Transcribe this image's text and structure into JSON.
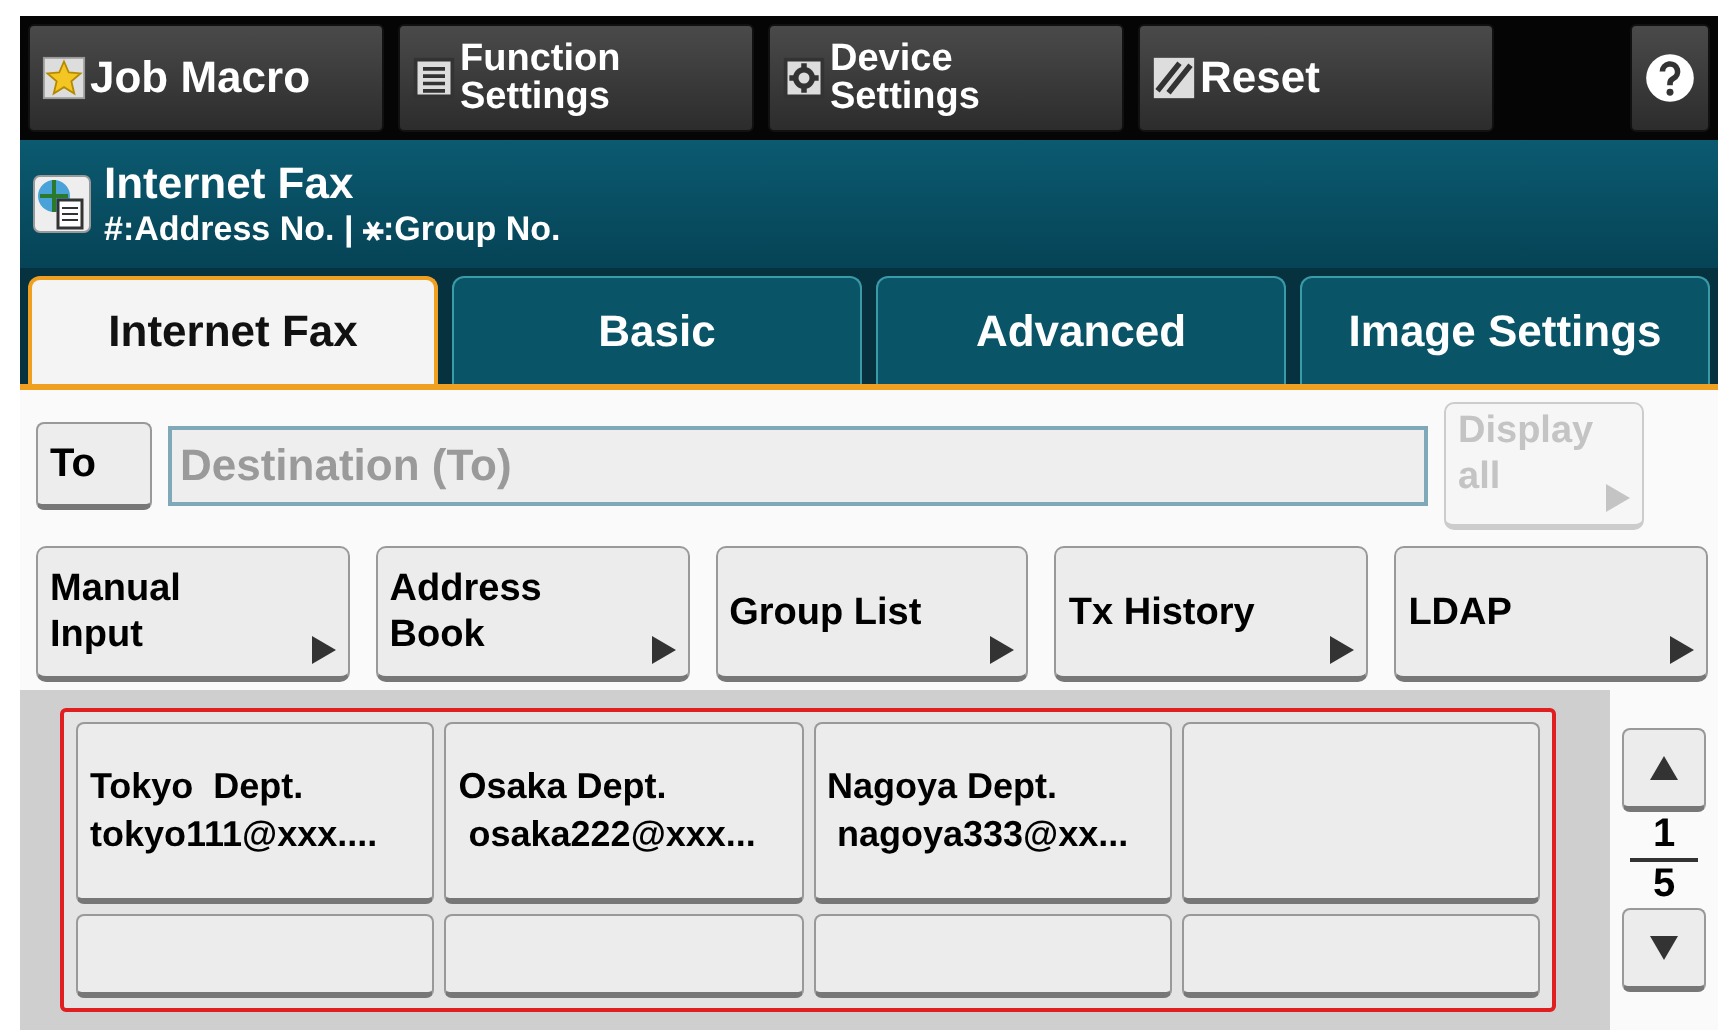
{
  "toolbar": [
    {
      "kind": "star",
      "label": "Job Macro"
    },
    {
      "kind": "list",
      "label": "Function\nSettings"
    },
    {
      "kind": "gear",
      "label": "Device\nSettings"
    },
    {
      "kind": "reset",
      "label": "Reset"
    },
    {
      "kind": "help"
    }
  ],
  "header": {
    "title": "Internet Fax",
    "subtitle": "#:Address No. | ⚹:Group No."
  },
  "tabs": [
    {
      "label": "Internet Fax",
      "selected": true
    },
    {
      "label": "Basic",
      "selected": false
    },
    {
      "label": "Advanced",
      "selected": false
    },
    {
      "label": "Image Settings",
      "selected": false
    }
  ],
  "destination": {
    "button": "To",
    "placeholder": "Destination (To)",
    "display_all": {
      "label": "Display\nall",
      "disabled": true
    }
  },
  "sources": [
    {
      "label": "Manual\nInput"
    },
    {
      "label": "Address\nBook"
    },
    {
      "label": "Group List"
    },
    {
      "label": "Tx History"
    },
    {
      "label": "LDAP"
    }
  ],
  "address_slots": [
    {
      "kind": "entry",
      "name": "Tokyo  Dept.",
      "address": "tokyo111@xxx...."
    },
    {
      "kind": "entry",
      "name": "Osaka Dept.",
      "address": " osaka222@xxx..."
    },
    {
      "kind": "entry",
      "name": "Nagoya Dept.",
      "address": " nagoya333@xx..."
    },
    {
      "kind": "empty"
    },
    {
      "kind": "empty"
    },
    {
      "kind": "empty"
    },
    {
      "kind": "empty"
    },
    {
      "kind": "empty"
    }
  ],
  "pager": {
    "page": "1",
    "total": "5"
  }
}
